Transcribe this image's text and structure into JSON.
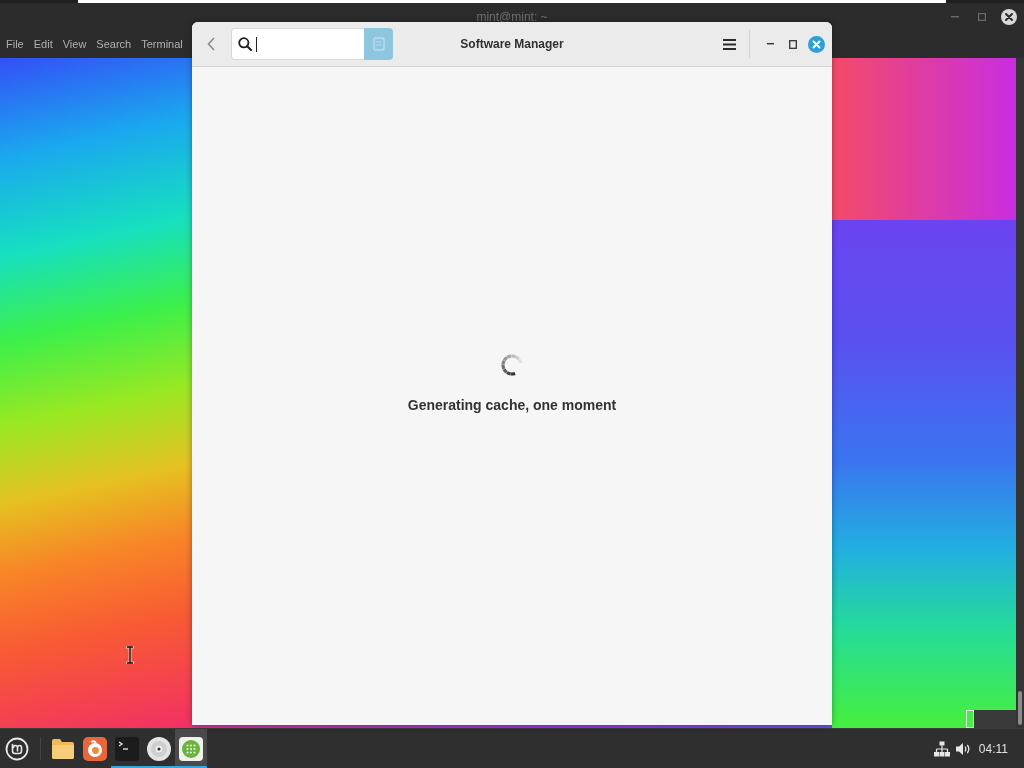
{
  "terminal_window": {
    "title": "mint@mint: ~",
    "menu": [
      "File",
      "Edit",
      "View",
      "Search",
      "Terminal"
    ]
  },
  "software_manager": {
    "title": "Software Manager",
    "search": {
      "focused": true
    },
    "loading": true,
    "message": "Generating cache, one moment"
  },
  "taskbar": {
    "launchers": [
      {
        "kind": "files",
        "running": false,
        "selected": false
      },
      {
        "kind": "browser",
        "running": false,
        "selected": false
      },
      {
        "kind": "terminal",
        "running": true,
        "selected": false
      },
      {
        "kind": "disc",
        "running": true,
        "selected": false
      },
      {
        "kind": "software",
        "running": true,
        "selected": true
      }
    ],
    "clock": "04:11"
  }
}
